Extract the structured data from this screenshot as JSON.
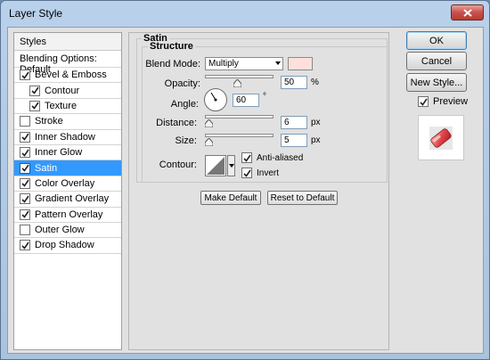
{
  "window": {
    "title": "Layer Style"
  },
  "styles_panel": {
    "header": "Styles",
    "blending_options": "Blending Options: Default",
    "items": [
      {
        "label": "Bevel & Emboss",
        "checked": true,
        "sub": false,
        "selected": false
      },
      {
        "label": "Contour",
        "checked": true,
        "sub": true,
        "selected": false
      },
      {
        "label": "Texture",
        "checked": true,
        "sub": true,
        "selected": false
      },
      {
        "label": "Stroke",
        "checked": false,
        "sub": false,
        "selected": false
      },
      {
        "label": "Inner Shadow",
        "checked": true,
        "sub": false,
        "selected": false
      },
      {
        "label": "Inner Glow",
        "checked": true,
        "sub": false,
        "selected": false
      },
      {
        "label": "Satin",
        "checked": true,
        "sub": false,
        "selected": true
      },
      {
        "label": "Color Overlay",
        "checked": true,
        "sub": false,
        "selected": false
      },
      {
        "label": "Gradient Overlay",
        "checked": true,
        "sub": false,
        "selected": false
      },
      {
        "label": "Pattern Overlay",
        "checked": true,
        "sub": false,
        "selected": false
      },
      {
        "label": "Outer Glow",
        "checked": false,
        "sub": false,
        "selected": false
      },
      {
        "label": "Drop Shadow",
        "checked": true,
        "sub": false,
        "selected": false
      }
    ]
  },
  "satin": {
    "group_title": "Satin",
    "structure_title": "Structure",
    "blend_mode_label": "Blend Mode:",
    "blend_mode_value": "Multiply",
    "swatch_color": "#fde0db",
    "opacity_label": "Opacity:",
    "opacity_value": "50",
    "opacity_unit": "%",
    "angle_label": "Angle:",
    "angle_value": "60",
    "angle_unit": "°",
    "distance_label": "Distance:",
    "distance_value": "6",
    "distance_unit": "px",
    "size_label": "Size:",
    "size_value": "5",
    "size_unit": "px",
    "contour_label": "Contour:",
    "anti_aliased_label": "Anti-aliased",
    "anti_aliased_checked": true,
    "invert_label": "Invert",
    "invert_checked": true,
    "make_default_label": "Make Default",
    "reset_default_label": "Reset to Default"
  },
  "actions": {
    "ok_label": "OK",
    "cancel_label": "Cancel",
    "new_style_label": "New Style...",
    "preview_label": "Preview",
    "preview_checked": true
  }
}
